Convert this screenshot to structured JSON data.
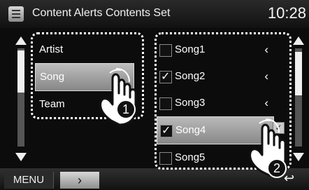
{
  "header": {
    "title": "Content Alerts Contents Set",
    "clock": "10:28"
  },
  "categories": [
    {
      "label": "Artist",
      "selected": false
    },
    {
      "label": "Song",
      "selected": true
    },
    {
      "label": "Team",
      "selected": false
    }
  ],
  "songs": [
    {
      "label": "Song1",
      "checked": false,
      "chevron": "‹",
      "selected": false
    },
    {
      "label": "Song2",
      "checked": true,
      "chevron": "‹",
      "selected": false
    },
    {
      "label": "Song3",
      "checked": false,
      "chevron": "‹",
      "selected": false
    },
    {
      "label": "Song4",
      "checked": true,
      "chevron": "",
      "selected": true
    },
    {
      "label": "Song5",
      "checked": false,
      "chevron": "",
      "selected": false
    }
  ],
  "bottom_bar": {
    "menu_label": "MENU",
    "next_glyph": "›",
    "back_glyph": "↩"
  },
  "annotations": {
    "step1": "1",
    "step2": "2"
  },
  "icons": {
    "app": "content-alerts-icon",
    "scroll_up": "scroll-up-icon",
    "scroll_down": "scroll-down-icon",
    "hand": "pointing-hand-icon"
  }
}
